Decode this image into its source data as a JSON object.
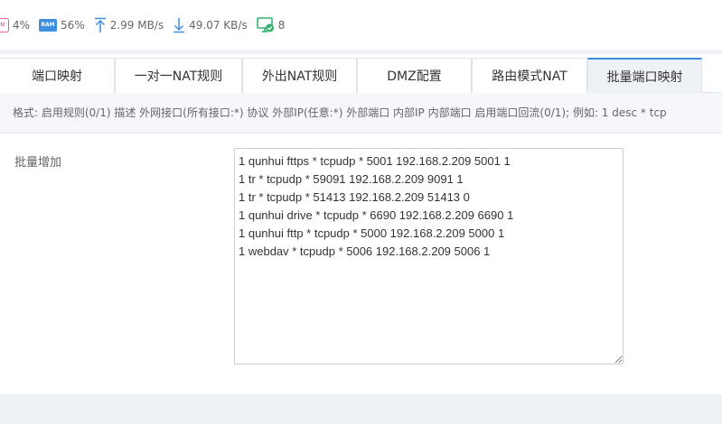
{
  "status": {
    "cpu": "4%",
    "ram": "56%",
    "ram_icon_text": "RAM",
    "upload": "2.99 MB/s",
    "download": "49.07 KB/s",
    "devices": "8"
  },
  "tabs": [
    {
      "label": "端口映射"
    },
    {
      "label": "一对一NAT规则"
    },
    {
      "label": "外出NAT规则"
    },
    {
      "label": "DMZ配置"
    },
    {
      "label": "路由模式NAT"
    },
    {
      "label": "批量端口映射",
      "active": true
    }
  ],
  "hint": "格式: 启用规则(0/1) 描述 外网接口(所有接口:*) 协议 外部IP(任意:*) 外部端口 内部IP 内部端口 启用端口回流(0/1); 例如: 1 desc * tcp",
  "form": {
    "label": "批量增加",
    "value": "1 qunhui fttps * tcpudp * 5001 192.168.2.209 5001 1\n1 tr * tcpudp * 59091 192.168.2.209 9091 1\n1 tr * tcpudp * 51413 192.168.2.209 51413 0\n1 qunhui drive * tcpudp * 6690 192.168.2.209 6690 1\n1 qunhui fttp * tcpudp * 5000 192.168.2.209 5000 1\n1 webdav * tcpudp * 5006 192.168.2.209 5006 1"
  },
  "colors": {
    "accent": "#3a8ee6",
    "cpu_icon": "#e55aa2",
    "ram_icon": "#3f8fe0",
    "device_icon": "#2fb36b"
  }
}
